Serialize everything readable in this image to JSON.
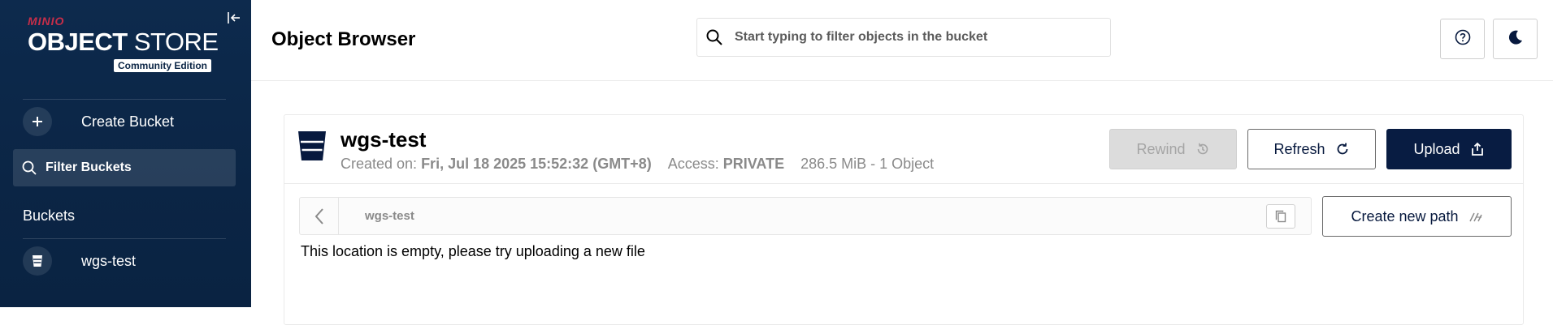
{
  "sidebar": {
    "logo": {
      "brand": "MINIO",
      "title_bold": "OBJECT",
      "title_light": " STORE",
      "edition": "Community Edition"
    },
    "create_bucket_label": "Create Bucket",
    "filter_buckets_label": "Filter Buckets",
    "buckets_section_label": "Buckets",
    "buckets": [
      {
        "label": "wgs-test"
      }
    ]
  },
  "header": {
    "title": "Object Browser",
    "search_placeholder": "Start typing to filter objects in the bucket"
  },
  "bucket": {
    "name": "wgs-test",
    "created_label": "Created on: ",
    "created_value": "Fri, Jul 18 2025 15:52:32 (GMT+8)",
    "access_label": "Access: ",
    "access_value": "PRIVATE",
    "size_summary": "286.5 MiB - 1 Object"
  },
  "actions": {
    "rewind_label": "Rewind",
    "refresh_label": "Refresh",
    "upload_label": "Upload",
    "create_path_label": "Create new path"
  },
  "browser": {
    "breadcrumb": "wgs-test",
    "empty_message": "This location is empty, please try uploading a new file"
  },
  "colors": {
    "sidebar_bg": "#0b2545",
    "brand_red": "#c72e49",
    "primary_button": "#081c42",
    "disabled_button": "#dcdcdc"
  },
  "icons": [
    "collapse-sidebar-icon",
    "plus-icon",
    "search-icon",
    "bucket-icon",
    "help-icon",
    "dark-mode-icon",
    "rewind-icon",
    "refresh-icon",
    "upload-icon",
    "chevron-left-icon",
    "copy-icon",
    "new-path-icon"
  ]
}
